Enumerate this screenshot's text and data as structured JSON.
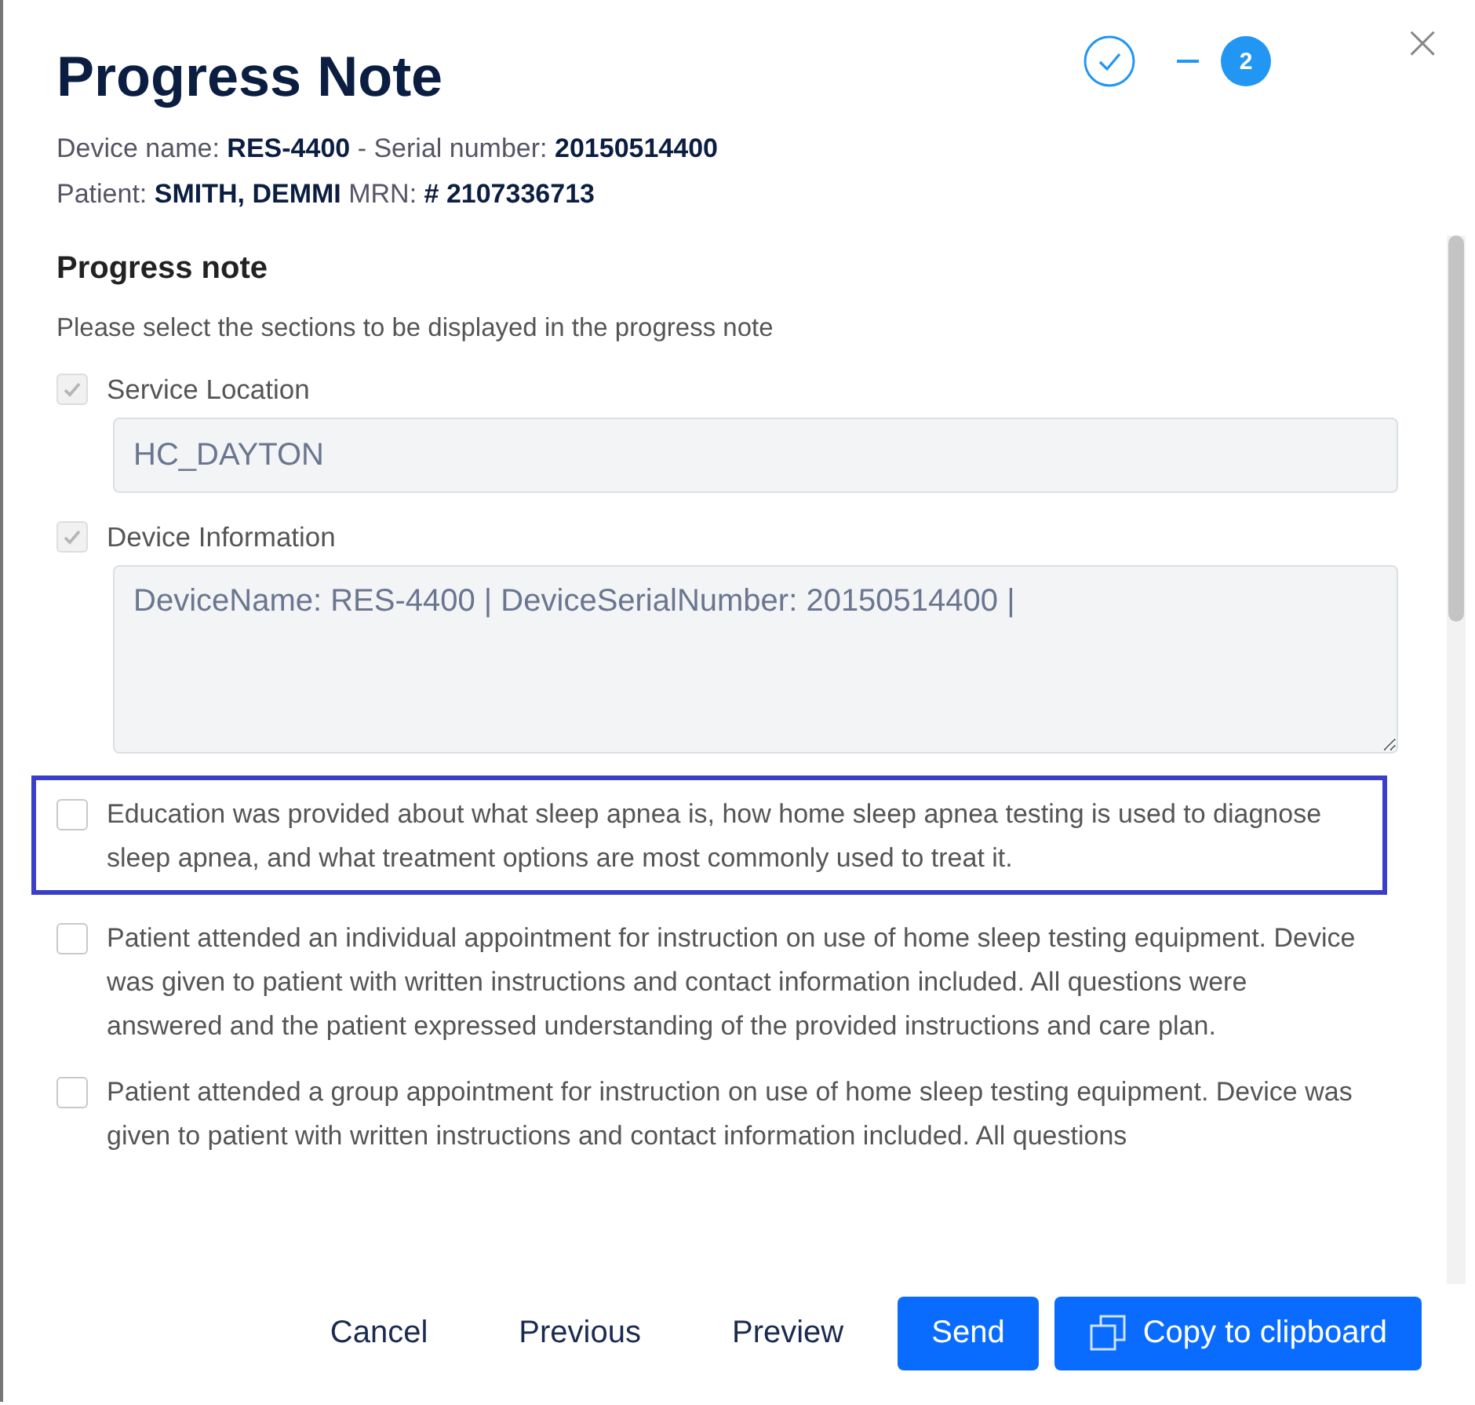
{
  "dialog": {
    "title": "Progress Note",
    "info_lines": [
      {
        "parts": [
          {
            "label": "Device name:",
            "value": "RES-4400"
          },
          {
            "label": "- Serial number:",
            "value": "20150514400"
          }
        ]
      },
      {
        "parts": [
          {
            "label": "Patient:",
            "value": "SMITH, DEMMI"
          },
          {
            "label": "MRN:",
            "value": "# 2107336713"
          }
        ]
      }
    ],
    "steps": [
      {
        "kind": "done"
      },
      {
        "kind": "current",
        "label": "2"
      }
    ],
    "close": "×"
  },
  "progress_note": {
    "heading": "Progress note",
    "description": "Please select the sections to be displayed in the progress note",
    "sections": [
      {
        "kind": "field",
        "label": "Service Location",
        "checked": true,
        "disabled": true,
        "value": "HC_DAYTON",
        "multiline": false
      },
      {
        "kind": "field",
        "label": "Device Information",
        "checked": true,
        "disabled": true,
        "value": "DeviceName: RES-4400 | DeviceSerialNumber: 20150514400 |",
        "multiline": true
      },
      {
        "kind": "statement",
        "text": "Education was provided about what sleep apnea is, how home sleep apnea testing is used to diagnose sleep apnea, and what treatment options are most commonly used to treat it.",
        "checked": false,
        "highlighted": true
      },
      {
        "kind": "statement",
        "text": "Patient attended an individual appointment for instruction on use of home sleep testing equipment. Device was given to patient with written instructions and contact information included. All questions were answered and the patient expressed understanding of the provided instructions and care plan.",
        "checked": false,
        "highlighted": false
      },
      {
        "kind": "statement",
        "text": "Patient attended a group appointment for instruction on use of home sleep testing equipment. Device was given to patient with written instructions and contact information included. All questions",
        "checked": false,
        "highlighted": false
      }
    ]
  },
  "buttons": [
    {
      "kind": "text",
      "label": "Cancel"
    },
    {
      "kind": "text",
      "label": "Previous"
    },
    {
      "kind": "text",
      "label": "Preview"
    },
    {
      "kind": "primary",
      "label": "Send",
      "icon": false
    },
    {
      "kind": "primary",
      "label": "Copy to clipboard",
      "icon": true
    }
  ]
}
